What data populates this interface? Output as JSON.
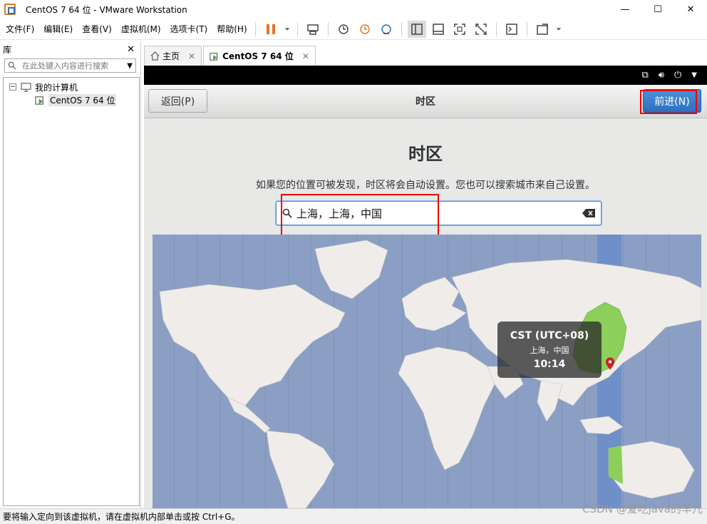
{
  "window": {
    "title": "CentOS 7 64 位 - VMware Workstation"
  },
  "menubar": {
    "items": [
      "文件(F)",
      "编辑(E)",
      "查看(V)",
      "虚拟机(M)",
      "选项卡(T)",
      "帮助(H)"
    ]
  },
  "sidebar": {
    "title": "库",
    "search_placeholder": "在此处键入内容进行搜索",
    "tree": {
      "root": "我的计算机",
      "child": "CentOS 7 64 位"
    }
  },
  "tabs": [
    {
      "label": "主页"
    },
    {
      "label": "CentOS 7 64 位"
    }
  ],
  "installer": {
    "back_label": "返回(P)",
    "header_title": "时区",
    "next_label": "前进(N)",
    "page_title": "时区",
    "description": "如果您的位置可被发现，时区将会自动设置。您也可以搜索城市来自己设置。",
    "search_value": "上海，上海，中国",
    "tooltip": {
      "timezone": "CST (UTC+08)",
      "city": "上海，中国",
      "time": "10:14"
    }
  },
  "statusbar": {
    "text": "要将输入定向到该虚拟机，请在虚拟机内部单击或按 Ctrl+G。"
  },
  "watermark": "CSDN @爱吃java的羊儿",
  "colors": {
    "accent": "#4a90d9",
    "highlight": "#e00000",
    "map_ocean": "#8b9fc4",
    "selected_zone": "#8ccf5a"
  }
}
